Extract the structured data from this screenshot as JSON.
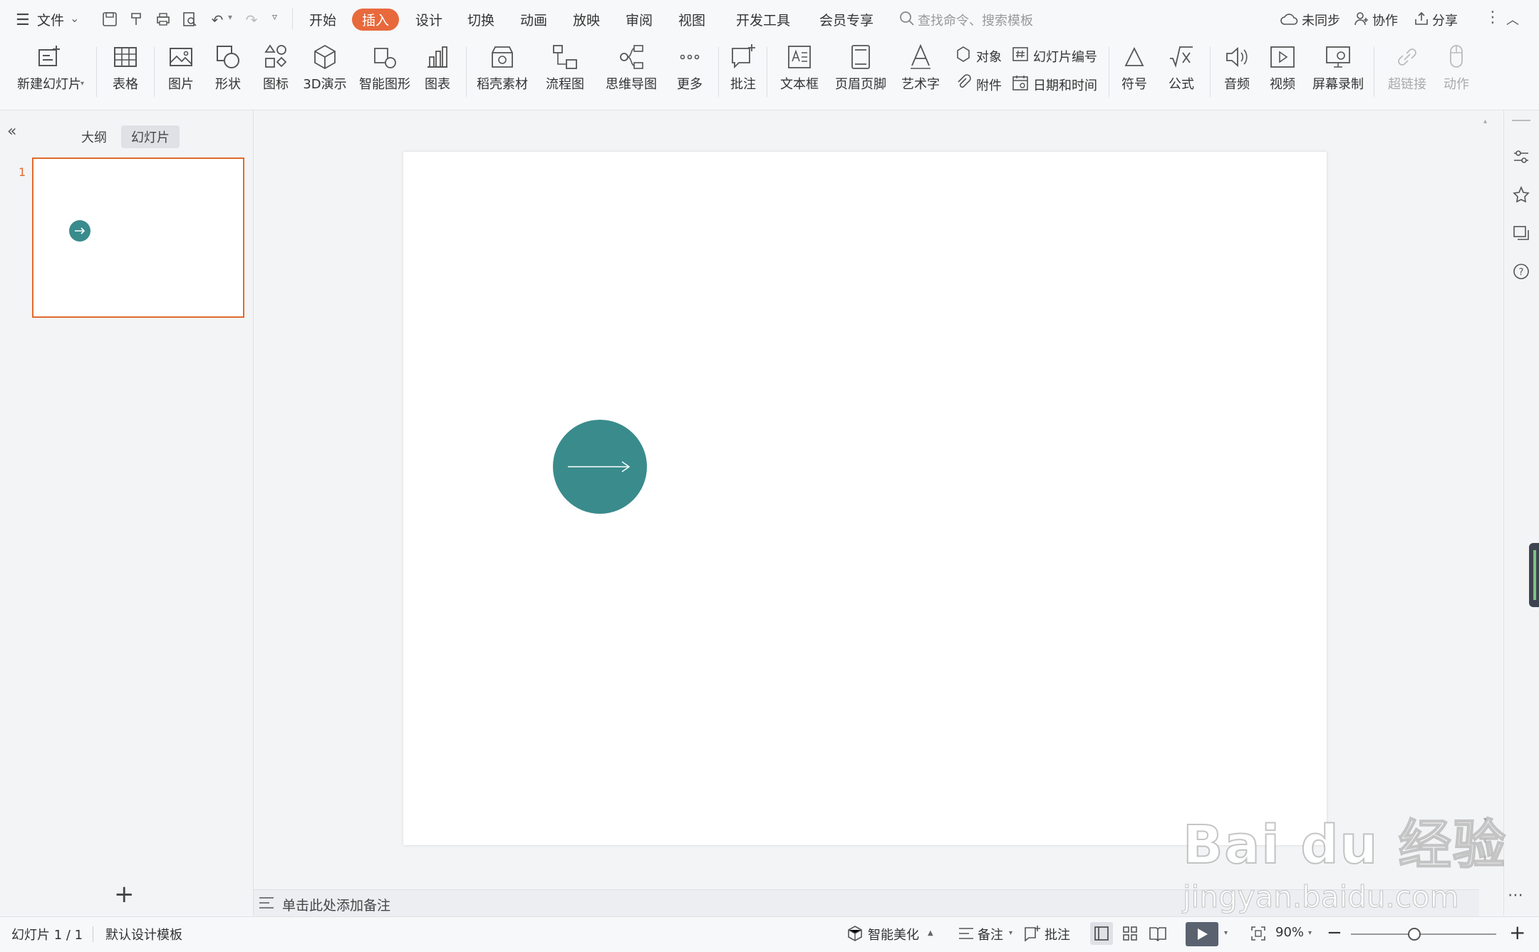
{
  "menubar": {
    "file_label": "文件",
    "tabs": [
      "开始",
      "插入",
      "设计",
      "切换",
      "动画",
      "放映",
      "审阅",
      "视图",
      "开发工具",
      "会员专享"
    ],
    "active_tab": "插入",
    "search_placeholder": "查找命令、搜索模板",
    "sync_label": "未同步",
    "collab_label": "协作",
    "share_label": "分享"
  },
  "ribbon": {
    "new_slide": "新建幻灯片",
    "table": "表格",
    "picture": "图片",
    "shape": "形状",
    "icon": "图标",
    "demo3d": "3D演示",
    "smart_graphic": "智能图形",
    "chart": "图表",
    "material": "稻壳素材",
    "flowchart": "流程图",
    "mindmap": "思维导图",
    "more": "更多",
    "comment": "批注",
    "textbox": "文本框",
    "header_footer": "页眉页脚",
    "wordart": "艺术字",
    "object": "对象",
    "slide_number": "幻灯片编号",
    "attachment": "附件",
    "datetime": "日期和时间",
    "symbol": "符号",
    "formula": "公式",
    "audio": "音频",
    "video": "视频",
    "screen_record": "屏幕录制",
    "hyperlink": "超链接",
    "action": "动作"
  },
  "leftpanel": {
    "tab_outline": "大纲",
    "tab_slides": "幻灯片",
    "slide_number": "1",
    "add_label": "+"
  },
  "slide": {
    "circle_color": "#3a8b8c"
  },
  "notes": {
    "placeholder": "单击此处添加备注"
  },
  "status": {
    "slide_info": "幻灯片 1 / 1",
    "template": "默认设计模板",
    "beautify": "智能美化",
    "notes_btn": "备注",
    "comment_btn": "批注",
    "zoom": "90%"
  },
  "watermark": {
    "brand": "Bai du 经验",
    "url": "jingyan.baidu.com"
  }
}
